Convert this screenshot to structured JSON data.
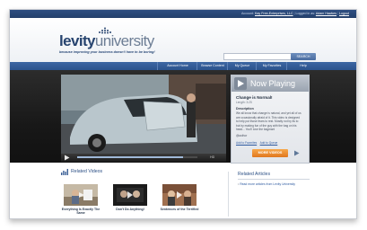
{
  "topbar": {
    "prefix": "Account: ",
    "account": "Kay Free-Enterprises, LLC",
    "logged_in_as": "Logged in as: ",
    "user": "Adam Hawkes",
    "logout": "Logout"
  },
  "logo": {
    "word_bold": "levity",
    "word_light": "university",
    "tagline": "because improving your business doesn't have to be boring!"
  },
  "search": {
    "placeholder": "",
    "button_label": "SEARCH"
  },
  "nav": {
    "items": [
      "Account Home",
      "Browse Content",
      "My Queue",
      "My Favorites",
      "Help"
    ]
  },
  "player": {
    "progress": 0.88,
    "quality_label": "HD"
  },
  "now_playing": {
    "title": "Now Playing",
    "video_title": "Change is Normal!",
    "length": "Length: 3:25",
    "description_label": "Description",
    "description": "We all know that change is natural, and yet all of us are occasionally afraid of it. This video is designed to help put those fears to rest. Mostly not by its to but by making fun of the guy with the bag on his head... You'll love the bagman!",
    "author": "@author",
    "link_favorites": "Add to Favorites",
    "link_queue": "Add to Queue",
    "more_button": "MORE VIDEOS"
  },
  "related_videos": {
    "title": "Related Videos",
    "items": [
      {
        "title": "Everything Is Exactly The Same"
      },
      {
        "title": "Don't Do Anything!"
      },
      {
        "title": "Sentences of the Terrified"
      }
    ]
  },
  "related_articles": {
    "title": "Related Articles",
    "items": [
      "Read more articles from Levity University"
    ]
  },
  "colors": {
    "brand_navy": "#27446f",
    "nav_blue": "#2f5893",
    "accent_orange": "#f0902f"
  }
}
